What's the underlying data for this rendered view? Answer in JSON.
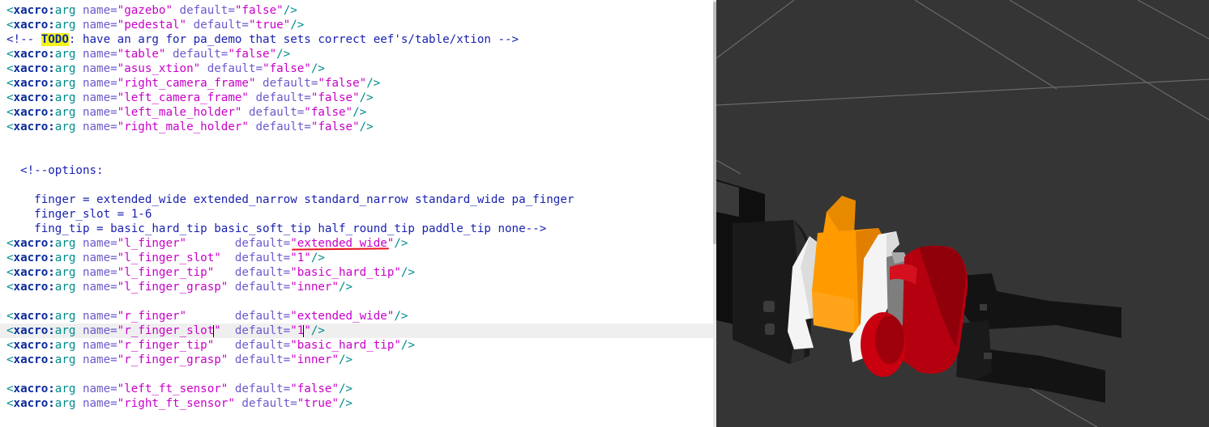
{
  "editor": {
    "lines": [
      [
        {
          "c": "tag",
          "t": "<"
        },
        {
          "c": "ns",
          "t": "xacro:"
        },
        {
          "c": "tag",
          "t": "arg"
        },
        {
          "c": "attr",
          "t": " name="
        },
        {
          "c": "str",
          "t": "\"gazebo\""
        },
        {
          "c": "attr",
          "t": " default="
        },
        {
          "c": "str",
          "t": "\"false\""
        },
        {
          "c": "tag",
          "t": "/>"
        }
      ],
      [
        {
          "c": "tag",
          "t": "<"
        },
        {
          "c": "ns",
          "t": "xacro:"
        },
        {
          "c": "tag",
          "t": "arg"
        },
        {
          "c": "attr",
          "t": " name="
        },
        {
          "c": "str",
          "t": "\"pedestal\""
        },
        {
          "c": "attr",
          "t": " default="
        },
        {
          "c": "str",
          "t": "\"true\""
        },
        {
          "c": "tag",
          "t": "/>"
        }
      ],
      [
        {
          "c": "com",
          "t": "<!-- "
        },
        {
          "c": "todo",
          "t": "TODO"
        },
        {
          "c": "com",
          "t": ": have an arg for pa_demo that sets correct eef's/table/xtion -->"
        }
      ],
      [
        {
          "c": "tag",
          "t": "<"
        },
        {
          "c": "ns",
          "t": "xacro:"
        },
        {
          "c": "tag",
          "t": "arg"
        },
        {
          "c": "attr",
          "t": " name="
        },
        {
          "c": "str",
          "t": "\"table\""
        },
        {
          "c": "attr",
          "t": " default="
        },
        {
          "c": "str",
          "t": "\"false\""
        },
        {
          "c": "tag",
          "t": "/>"
        }
      ],
      [
        {
          "c": "tag",
          "t": "<"
        },
        {
          "c": "ns",
          "t": "xacro:"
        },
        {
          "c": "tag",
          "t": "arg"
        },
        {
          "c": "attr",
          "t": " name="
        },
        {
          "c": "str",
          "t": "\"asus_xtion\""
        },
        {
          "c": "attr",
          "t": " default="
        },
        {
          "c": "str",
          "t": "\"false\""
        },
        {
          "c": "tag",
          "t": "/>"
        }
      ],
      [
        {
          "c": "tag",
          "t": "<"
        },
        {
          "c": "ns",
          "t": "xacro:"
        },
        {
          "c": "tag",
          "t": "arg"
        },
        {
          "c": "attr",
          "t": " name="
        },
        {
          "c": "str",
          "t": "\"right_camera_frame\""
        },
        {
          "c": "attr",
          "t": " default="
        },
        {
          "c": "str",
          "t": "\"false\""
        },
        {
          "c": "tag",
          "t": "/>"
        }
      ],
      [
        {
          "c": "tag",
          "t": "<"
        },
        {
          "c": "ns",
          "t": "xacro:"
        },
        {
          "c": "tag",
          "t": "arg"
        },
        {
          "c": "attr",
          "t": " name="
        },
        {
          "c": "str",
          "t": "\"left_camera_frame\""
        },
        {
          "c": "attr",
          "t": " default="
        },
        {
          "c": "str",
          "t": "\"false\""
        },
        {
          "c": "tag",
          "t": "/>"
        }
      ],
      [
        {
          "c": "tag",
          "t": "<"
        },
        {
          "c": "ns",
          "t": "xacro:"
        },
        {
          "c": "tag",
          "t": "arg"
        },
        {
          "c": "attr",
          "t": " name="
        },
        {
          "c": "str",
          "t": "\"left_male_holder\""
        },
        {
          "c": "attr",
          "t": " default="
        },
        {
          "c": "str",
          "t": "\"false\""
        },
        {
          "c": "tag",
          "t": "/>"
        }
      ],
      [
        {
          "c": "tag",
          "t": "<"
        },
        {
          "c": "ns",
          "t": "xacro:"
        },
        {
          "c": "tag",
          "t": "arg"
        },
        {
          "c": "attr",
          "t": " name="
        },
        {
          "c": "str",
          "t": "\"right_male_holder\""
        },
        {
          "c": "attr",
          "t": " default="
        },
        {
          "c": "str",
          "t": "\"false\""
        },
        {
          "c": "tag",
          "t": "/>"
        }
      ],
      [],
      [],
      [
        {
          "c": "com",
          "t": "  <!--options:"
        }
      ],
      [],
      [
        {
          "c": "com",
          "t": "    finger = extended_wide extended_narrow standard_narrow standard_wide pa_finger"
        }
      ],
      [
        {
          "c": "com",
          "t": "    finger_slot = 1-6"
        }
      ],
      [
        {
          "c": "com",
          "t": "    fing_tip = basic_hard_tip basic_soft_tip half_round_tip paddle_tip none-->"
        }
      ],
      [
        {
          "c": "tag",
          "t": "<"
        },
        {
          "c": "ns",
          "t": "xacro:"
        },
        {
          "c": "tag",
          "t": "arg"
        },
        {
          "c": "attr",
          "t": " name="
        },
        {
          "c": "str",
          "t": "\"l_finger\""
        },
        {
          "c": "attr",
          "t": "       default="
        },
        {
          "c": "str",
          "t": "\"extended_wide\""
        },
        {
          "c": "tag",
          "t": "/>"
        }
      ],
      [
        {
          "c": "tag",
          "t": "<"
        },
        {
          "c": "ns",
          "t": "xacro:"
        },
        {
          "c": "tag",
          "t": "arg"
        },
        {
          "c": "attr",
          "t": " name="
        },
        {
          "c": "str",
          "t": "\"l_finger_slot\""
        },
        {
          "c": "attr",
          "t": "  default="
        },
        {
          "c": "str",
          "t": "\"1\""
        },
        {
          "c": "tag",
          "t": "/>"
        }
      ],
      [
        {
          "c": "tag",
          "t": "<"
        },
        {
          "c": "ns",
          "t": "xacro:"
        },
        {
          "c": "tag",
          "t": "arg"
        },
        {
          "c": "attr",
          "t": " name="
        },
        {
          "c": "str",
          "t": "\"l_finger_tip\""
        },
        {
          "c": "attr",
          "t": "   default="
        },
        {
          "c": "str",
          "t": "\"basic_hard_tip\""
        },
        {
          "c": "tag",
          "t": "/>"
        }
      ],
      [
        {
          "c": "tag",
          "t": "<"
        },
        {
          "c": "ns",
          "t": "xacro:"
        },
        {
          "c": "tag",
          "t": "arg"
        },
        {
          "c": "attr",
          "t": " name="
        },
        {
          "c": "str",
          "t": "\"l_finger_grasp\""
        },
        {
          "c": "attr",
          "t": " default="
        },
        {
          "c": "str",
          "t": "\"inner\""
        },
        {
          "c": "tag",
          "t": "/>"
        }
      ],
      [],
      [
        {
          "c": "tag",
          "t": "<"
        },
        {
          "c": "ns",
          "t": "xacro:"
        },
        {
          "c": "tag",
          "t": "arg"
        },
        {
          "c": "attr",
          "t": " name="
        },
        {
          "c": "str",
          "t": "\"r_finger\""
        },
        {
          "c": "attr",
          "t": "       default="
        },
        {
          "c": "str",
          "t": "\"extended_wide\""
        },
        {
          "c": "tag",
          "t": "/>"
        }
      ],
      [
        {
          "c": "tag",
          "t": "<"
        },
        {
          "c": "ns",
          "t": "xacro:"
        },
        {
          "c": "tag",
          "t": "arg"
        },
        {
          "c": "attr",
          "t": " name="
        },
        {
          "c": "str",
          "t": "\"r_finger_slot\""
        },
        {
          "c": "attr",
          "t": "  default="
        },
        {
          "c": "str",
          "t": "\"1\""
        },
        {
          "c": "tag",
          "t": "/>"
        }
      ],
      [
        {
          "c": "tag",
          "t": "<"
        },
        {
          "c": "ns",
          "t": "xacro:"
        },
        {
          "c": "tag",
          "t": "arg"
        },
        {
          "c": "attr",
          "t": " name="
        },
        {
          "c": "str",
          "t": "\"r_finger_tip\""
        },
        {
          "c": "attr",
          "t": "   default="
        },
        {
          "c": "str",
          "t": "\"basic_hard_tip\""
        },
        {
          "c": "tag",
          "t": "/>"
        }
      ],
      [
        {
          "c": "tag",
          "t": "<"
        },
        {
          "c": "ns",
          "t": "xacro:"
        },
        {
          "c": "tag",
          "t": "arg"
        },
        {
          "c": "attr",
          "t": " name="
        },
        {
          "c": "str",
          "t": "\"r_finger_grasp\""
        },
        {
          "c": "attr",
          "t": " default="
        },
        {
          "c": "str",
          "t": "\"inner\""
        },
        {
          "c": "tag",
          "t": "/>"
        }
      ],
      [],
      [
        {
          "c": "tag",
          "t": "<"
        },
        {
          "c": "ns",
          "t": "xacro:"
        },
        {
          "c": "tag",
          "t": "arg"
        },
        {
          "c": "attr",
          "t": " name="
        },
        {
          "c": "str",
          "t": "\"left_ft_sensor\""
        },
        {
          "c": "attr",
          "t": " default="
        },
        {
          "c": "str",
          "t": "\"false\""
        },
        {
          "c": "tag",
          "t": "/>"
        }
      ],
      [
        {
          "c": "tag",
          "t": "<"
        },
        {
          "c": "ns",
          "t": "xacro:"
        },
        {
          "c": "tag",
          "t": "arg"
        },
        {
          "c": "attr",
          "t": " name="
        },
        {
          "c": "str",
          "t": "\"right_ft_sensor\""
        },
        {
          "c": "attr",
          "t": " default="
        },
        {
          "c": "str",
          "t": "\"true\""
        },
        {
          "c": "tag",
          "t": "/>"
        }
      ]
    ],
    "current_line": 22,
    "annotated_value": "extended_wide",
    "annotation_color": "#e8141e"
  },
  "viewport": {
    "background": "#353535",
    "grid_color": "#6a6a6a",
    "colors": {
      "orange": "#ff9a00",
      "red": "#c00010",
      "white": "#f4f4f4",
      "black": "#141414",
      "grey": "#8a8a8a"
    }
  }
}
